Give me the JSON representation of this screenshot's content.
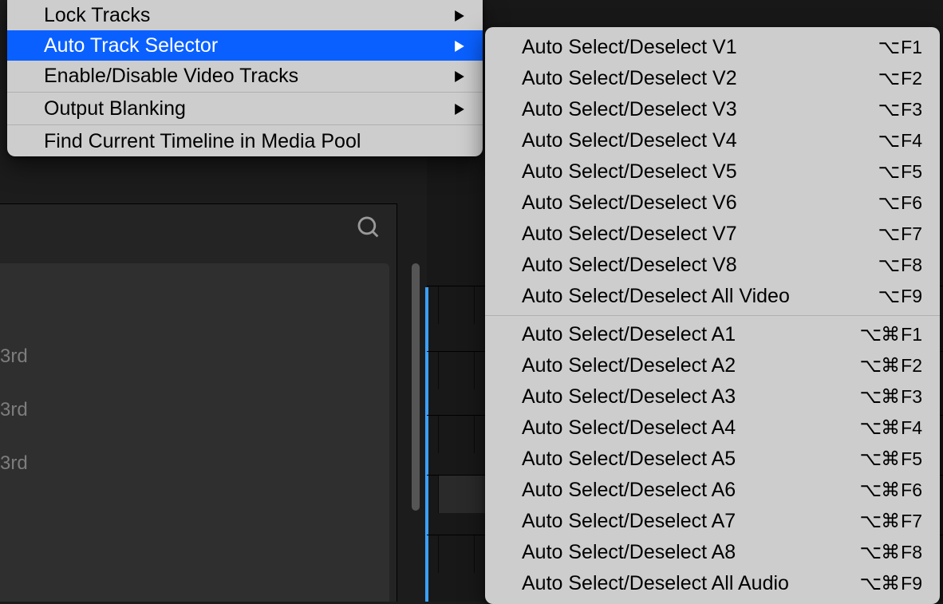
{
  "bg": {
    "labels": [
      "3rd",
      "3rd",
      "3rd"
    ]
  },
  "menu": {
    "items": [
      {
        "label": "Lock Tracks",
        "submenu": true
      },
      {
        "label": "Auto Track Selector",
        "submenu": true,
        "selected": true
      },
      {
        "label": "Enable/Disable Video Tracks",
        "submenu": true
      },
      {
        "sep": true
      },
      {
        "label": "Output Blanking",
        "submenu": true
      },
      {
        "sep": true
      },
      {
        "label": "Find Current Timeline in Media Pool",
        "submenu": false
      }
    ]
  },
  "submenu": {
    "items": [
      {
        "label": "Auto Select/Deselect V1",
        "shortcut": {
          "mods": "⌥",
          "key": "F1"
        }
      },
      {
        "label": "Auto Select/Deselect V2",
        "shortcut": {
          "mods": "⌥",
          "key": "F2"
        }
      },
      {
        "label": "Auto Select/Deselect V3",
        "shortcut": {
          "mods": "⌥",
          "key": "F3"
        }
      },
      {
        "label": "Auto Select/Deselect V4",
        "shortcut": {
          "mods": "⌥",
          "key": "F4"
        }
      },
      {
        "label": "Auto Select/Deselect V5",
        "shortcut": {
          "mods": "⌥",
          "key": "F5"
        }
      },
      {
        "label": "Auto Select/Deselect V6",
        "shortcut": {
          "mods": "⌥",
          "key": "F6"
        }
      },
      {
        "label": "Auto Select/Deselect V7",
        "shortcut": {
          "mods": "⌥",
          "key": "F7"
        }
      },
      {
        "label": "Auto Select/Deselect V8",
        "shortcut": {
          "mods": "⌥",
          "key": "F8"
        }
      },
      {
        "label": "Auto Select/Deselect All Video",
        "shortcut": {
          "mods": "⌥",
          "key": "F9"
        }
      },
      {
        "sep": true
      },
      {
        "label": "Auto Select/Deselect A1",
        "shortcut": {
          "mods": "⌥⌘",
          "key": "F1"
        }
      },
      {
        "label": "Auto Select/Deselect A2",
        "shortcut": {
          "mods": "⌥⌘",
          "key": "F2"
        }
      },
      {
        "label": "Auto Select/Deselect A3",
        "shortcut": {
          "mods": "⌥⌘",
          "key": "F3"
        }
      },
      {
        "label": "Auto Select/Deselect A4",
        "shortcut": {
          "mods": "⌥⌘",
          "key": "F4"
        }
      },
      {
        "label": "Auto Select/Deselect A5",
        "shortcut": {
          "mods": "⌥⌘",
          "key": "F5"
        }
      },
      {
        "label": "Auto Select/Deselect A6",
        "shortcut": {
          "mods": "⌥⌘",
          "key": "F6"
        }
      },
      {
        "label": "Auto Select/Deselect A7",
        "shortcut": {
          "mods": "⌥⌘",
          "key": "F7"
        }
      },
      {
        "label": "Auto Select/Deselect A8",
        "shortcut": {
          "mods": "⌥⌘",
          "key": "F8"
        }
      },
      {
        "label": "Auto Select/Deselect All Audio",
        "shortcut": {
          "mods": "⌥⌘",
          "key": "F9"
        }
      }
    ]
  }
}
